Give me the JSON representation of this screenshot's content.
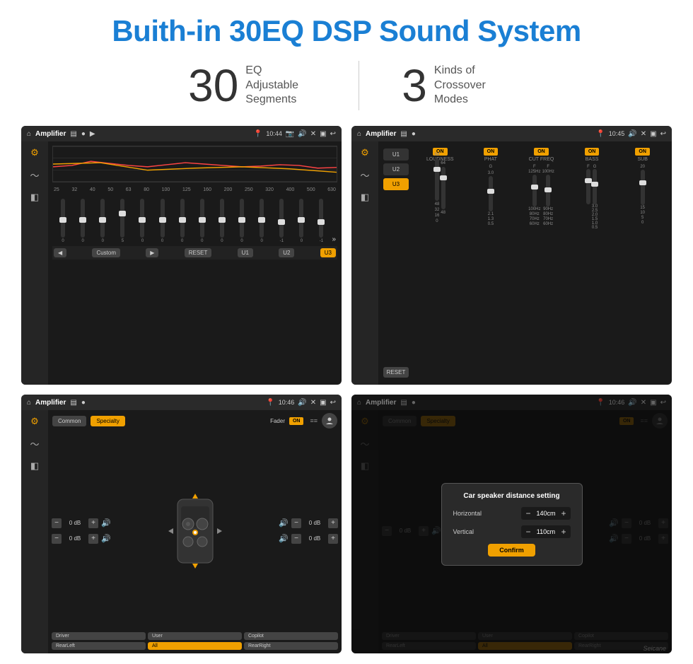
{
  "page": {
    "title": "Buith-in 30EQ DSP Sound System",
    "stat1_number": "30",
    "stat1_label_line1": "EQ Adjustable",
    "stat1_label_line2": "Segments",
    "stat2_number": "3",
    "stat2_label_line1": "Kinds of",
    "stat2_label_line2": "Crossover Modes"
  },
  "screen1": {
    "title": "Amplifier",
    "time": "10:44",
    "freq_labels": [
      "25",
      "32",
      "40",
      "50",
      "63",
      "80",
      "100",
      "125",
      "160",
      "200",
      "250",
      "320",
      "400",
      "500",
      "630"
    ],
    "slider_values": [
      "0",
      "0",
      "0",
      "0",
      "5",
      "0",
      "0",
      "0",
      "0",
      "0",
      "0",
      "0",
      "-1",
      "0",
      "-1"
    ],
    "controls": {
      "prev": "◀",
      "label": "Custom",
      "next": "▶",
      "reset": "RESET",
      "u1": "U1",
      "u2": "U2",
      "u3": "U3"
    }
  },
  "screen2": {
    "title": "Amplifier",
    "time": "10:45",
    "presets": [
      "U1",
      "U2",
      "U3"
    ],
    "active_preset": "U3",
    "reset_label": "RESET",
    "channels": [
      {
        "label": "LOUDNESS",
        "toggle": "ON"
      },
      {
        "label": "PHAT",
        "toggle": "ON"
      },
      {
        "label": "CUT FREQ",
        "toggle": "ON"
      },
      {
        "label": "BASS",
        "toggle": "ON"
      },
      {
        "label": "SUB",
        "toggle": "ON"
      }
    ]
  },
  "screen3": {
    "title": "Amplifier",
    "time": "10:46",
    "tab_common": "Common",
    "tab_specialty": "Specialty",
    "active_tab": "Specialty",
    "fader_label": "Fader",
    "fader_toggle": "ON",
    "speakers": {
      "fl_db": "0 dB",
      "fr_db": "0 dB",
      "rl_db": "0 dB",
      "rr_db": "0 dB"
    },
    "zone_btns": [
      "Driver",
      "RearLeft",
      "All",
      "User",
      "Copilot",
      "RearRight"
    ]
  },
  "screen4": {
    "title": "Amplifier",
    "time": "10:46",
    "tab_common": "Common",
    "tab_specialty": "Specialty",
    "dialog": {
      "title": "Car speaker distance setting",
      "horizontal_label": "Horizontal",
      "horizontal_value": "140cm",
      "vertical_label": "Vertical",
      "vertical_value": "110cm",
      "confirm_label": "Confirm"
    },
    "speakers": {
      "fr_db": "0 dB",
      "rr_db": "0 dB"
    },
    "zone_btns": [
      "Driver",
      "RearLeft",
      "All",
      "User",
      "Copilot",
      "RearRight"
    ]
  },
  "watermark": "Seicane"
}
